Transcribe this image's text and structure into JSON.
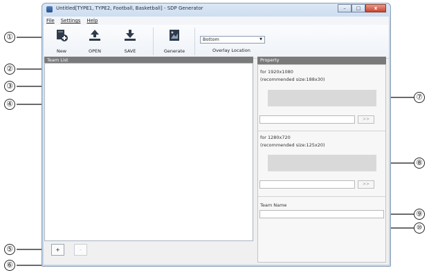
{
  "window": {
    "title": "Untitled[TYPE1, TYPE2, Football, Basketball] - SDP Generator",
    "controls": {
      "minimize": "–",
      "maximize": "□",
      "close": "x"
    }
  },
  "menu": [
    "File",
    "Settings",
    "Help"
  ],
  "toolbar": {
    "new_label": "New",
    "open_label": "OPEN",
    "save_label": "SAVE",
    "generate_label": "Generate",
    "overlay_location_value": "Bottom",
    "overlay_location_label": "Overlay Location"
  },
  "team_list": {
    "header": "Team List",
    "add_button": "+",
    "remove_button": "-"
  },
  "property": {
    "header": "Property",
    "res_1080": {
      "title": "for 1920x1080",
      "hint": "(recommended size:188x30)",
      "browse": ">>"
    },
    "res_720": {
      "title": "for 1280x720",
      "hint": "(recommended size:125x20)",
      "browse": ">>"
    },
    "team_name_label": "Team Name"
  },
  "callouts": [
    "①",
    "②",
    "③",
    "④",
    "⑤",
    "⑥",
    "⑦",
    "⑧",
    "⑨",
    "⑩"
  ],
  "colors": {
    "panel_header": "#7a7a7a",
    "preview": "#d9d9d9",
    "window_frame": "#cbdcf0"
  }
}
